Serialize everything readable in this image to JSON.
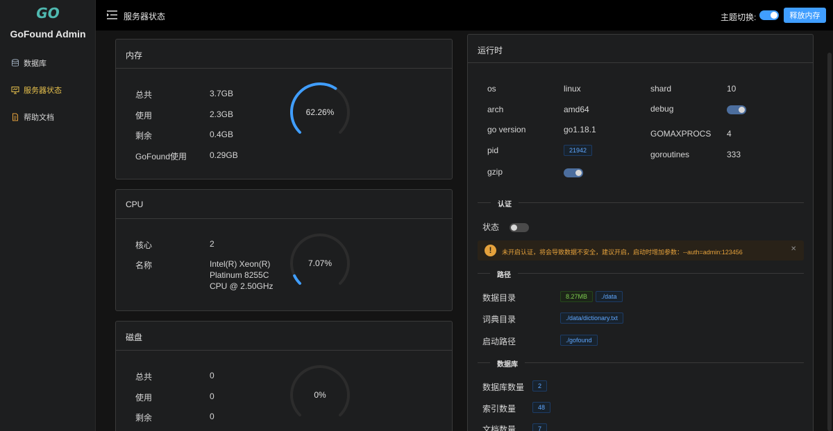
{
  "app": {
    "logo_text": "GO",
    "title": "GoFound Admin"
  },
  "sidebar": {
    "items": [
      {
        "label": "数据库",
        "icon": "database-icon",
        "active": false
      },
      {
        "label": "服务器状态",
        "icon": "monitor-icon",
        "active": true
      },
      {
        "label": "帮助文档",
        "icon": "document-icon",
        "active": false
      }
    ]
  },
  "header": {
    "title": "服务器状态",
    "theme_label": "主题切换:",
    "theme_toggle_on": true,
    "release_button": "释放内存"
  },
  "memory": {
    "title": "内存",
    "rows": [
      {
        "label": "总共",
        "value": "3.7GB"
      },
      {
        "label": "使用",
        "value": "2.3GB"
      },
      {
        "label": "剩余",
        "value": "0.4GB"
      },
      {
        "label": "GoFound使用",
        "value": "0.29GB"
      }
    ],
    "gauge_text": "62.26%",
    "gauge_percent": 62.26
  },
  "cpu": {
    "title": "CPU",
    "rows": [
      {
        "label": "核心",
        "value": "2"
      },
      {
        "label": "名称",
        "value_lines": [
          "Intel(R) Xeon(R)",
          "Platinum 8255C",
          "CPU @ 2.50GHz"
        ]
      }
    ],
    "gauge_text": "7.07%",
    "gauge_percent": 7.07
  },
  "disk": {
    "title": "磁盘",
    "rows": [
      {
        "label": "总共",
        "value": "0"
      },
      {
        "label": "使用",
        "value": "0"
      },
      {
        "label": "剩余",
        "value": "0"
      }
    ],
    "gauge_text": "0%",
    "gauge_percent": 0
  },
  "runtime": {
    "title": "运行时",
    "left": [
      {
        "key": "os",
        "value": "linux"
      },
      {
        "key": "arch",
        "value": "amd64"
      },
      {
        "key": "go version",
        "value": "go1.18.1"
      },
      {
        "key": "pid",
        "tag": "21942"
      },
      {
        "key": "gzip",
        "switch_on": true
      }
    ],
    "right": [
      {
        "key": "shard",
        "value": "10"
      },
      {
        "key": "debug",
        "switch_on": true
      },
      {
        "key": "GOMAXPROCS",
        "value": "4"
      },
      {
        "key": "goroutines",
        "value": "333"
      }
    ]
  },
  "auth": {
    "section": "认证",
    "status_label": "状态",
    "status_on": false,
    "warning": "未开启认证，将会导致数据不安全，建议开启，启动时增加参数：--auth=admin:123456",
    "warning_icon": "exclamation-icon",
    "close_icon": "close-icon"
  },
  "paths": {
    "section": "路径",
    "rows": [
      {
        "label": "数据目录",
        "tags": [
          {
            "text": "8.27MB",
            "style": "green"
          },
          {
            "text": "./data",
            "style": "blue"
          }
        ]
      },
      {
        "label": "词典目录",
        "tags": [
          {
            "text": "./data/dictionary.txt",
            "style": "blue"
          }
        ]
      },
      {
        "label": "启动路径",
        "tags": [
          {
            "text": "./gofound",
            "style": "blue"
          }
        ]
      }
    ]
  },
  "database": {
    "section": "数据库",
    "rows": [
      {
        "label": "数据库数量",
        "tag": "2"
      },
      {
        "label": "索引数量",
        "tag": "48"
      },
      {
        "label": "文档数量",
        "tag": "7"
      }
    ]
  },
  "colors": {
    "accent": "#409eff",
    "active_nav": "#e6c04c",
    "warning": "#e6a23c",
    "success": "#7ecb4f"
  }
}
